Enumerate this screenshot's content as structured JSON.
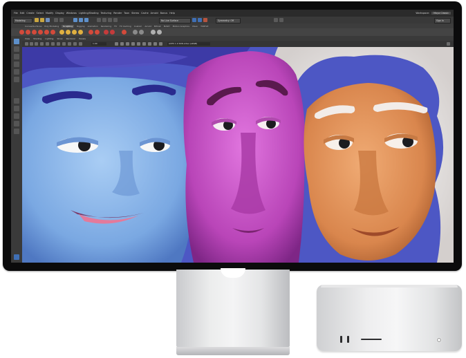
{
  "app": {
    "menus": [
      "File",
      "Edit",
      "Create",
      "Select",
      "Modify",
      "Display",
      "Windows",
      "Lighting/Shading",
      "Texturing",
      "Render",
      "Toon",
      "Stereo",
      "Cache",
      "Arnold",
      "Bonus",
      "Help"
    ],
    "workspace_label": "Workspace:",
    "workspace_value": "Maya Classic",
    "mode_dropdown": "Modeling",
    "render_field": "No Live Surface",
    "symmetry_label": "Symmetry: Off",
    "signin": "Sign In",
    "shelf_tabs": [
      "Curves/Surfaces",
      "Poly Modeling",
      "Sculpting",
      "Rigging",
      "Animation",
      "Rendering",
      "FX",
      "FX Caching",
      "Custom",
      "Arnold",
      "Bifrost",
      "MASH",
      "Motion Graphics",
      "XGen",
      "TURTLE"
    ],
    "active_shelf": "Sculpting",
    "panel_menus": [
      "View",
      "Shading",
      "Lighting",
      "Show",
      "Renderer",
      "Panels"
    ],
    "camera_value": "1.00",
    "color_space": "ACES 1.0 SDR-video (sRGB)"
  },
  "hardware": {
    "display": "studio-display",
    "computer": "mac-studio"
  },
  "colors": {
    "accent": "#5d8fc9",
    "blue_face": "#8fb8ea",
    "pink_face": "#c64fc4",
    "orange_face": "#e0915c",
    "hair_blue": "#3f3fa8",
    "hair_white": "#f3f0ee"
  }
}
